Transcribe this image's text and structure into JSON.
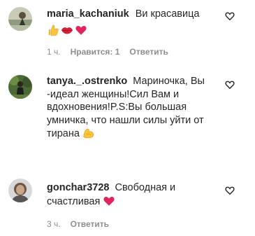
{
  "comments": [
    {
      "username": "maria_kachaniuk",
      "text": "Ви красавица",
      "emoji_names": [
        "thumbs-up-icon",
        "lips-icon",
        "heart-icon"
      ],
      "time": "1 ч.",
      "likes": "Нравится: 1",
      "reply": "Ответить"
    },
    {
      "username": "tanya._.ostrenko",
      "text": "Мариночка, Вы -идеал женщины!Сил Вам и вдохновения!P.S:Вы большая умничка, что нашли силы уйти от тирана",
      "emoji_names": [
        "flexed-biceps-icon"
      ]
    },
    {
      "username": "gonchar3728",
      "text": "Свободная и счастливая",
      "emoji_names": [
        "heart-icon"
      ],
      "time": "3 ч.",
      "reply": "Ответить"
    }
  ],
  "colors": {
    "text": "#262626",
    "meta": "#8e8e8e",
    "heart_emoji": "#e0245e"
  }
}
